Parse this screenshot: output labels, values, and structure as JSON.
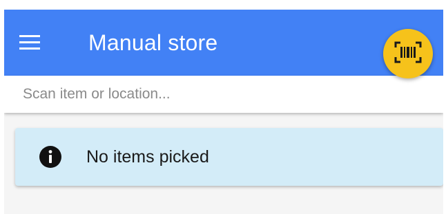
{
  "app_bar": {
    "title": "Manual store",
    "background_color": "#4281f5",
    "menu_icon": "menu-icon",
    "scan_button_icon": "barcode-scan-icon",
    "scan_button_color": "#f6c21b"
  },
  "search": {
    "placeholder": "Scan item or location...",
    "value": ""
  },
  "notice": {
    "icon": "info-icon",
    "message": "No items picked",
    "background_color": "#d3ecf8"
  }
}
